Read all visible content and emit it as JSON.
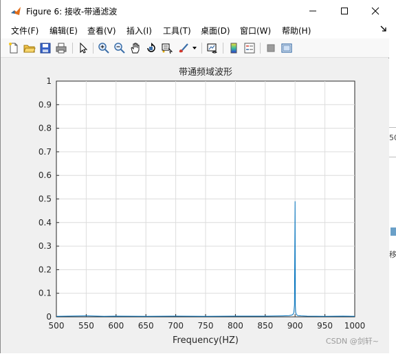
{
  "window": {
    "title": "Figure 6: 接收-带通滤波",
    "minimize_icon": "minimize-icon",
    "maximize_icon": "maximize-icon",
    "close_icon": "close-icon"
  },
  "menu": {
    "items": [
      {
        "label": "文件(F)"
      },
      {
        "label": "编辑(E)"
      },
      {
        "label": "查看(V)"
      },
      {
        "label": "插入(I)"
      },
      {
        "label": "工具(T)"
      },
      {
        "label": "桌面(D)"
      },
      {
        "label": "窗口(W)"
      },
      {
        "label": "帮助(H)"
      }
    ]
  },
  "toolbar": {
    "icons": [
      "new-figure-icon",
      "open-file-icon",
      "save-icon",
      "print-icon",
      "select-arrow-icon",
      "zoom-in-icon",
      "zoom-out-icon",
      "pan-icon",
      "rotate-3d-icon",
      "data-cursor-icon",
      "brush-icon",
      "link-plot-icon",
      "colorbar-icon",
      "legend-icon",
      "hide-plot-tools-icon",
      "show-plot-tools-icon"
    ]
  },
  "chart_data": {
    "type": "line",
    "title": "带通频域波形",
    "xlabel": "Frequency(HZ)",
    "ylabel": "",
    "xlim": [
      500,
      1000
    ],
    "ylim": [
      0,
      1
    ],
    "xticks": [
      "500",
      "550",
      "600",
      "650",
      "700",
      "750",
      "800",
      "850",
      "900",
      "950",
      "1000"
    ],
    "yticks": [
      "0",
      "0.1",
      "0.2",
      "0.3",
      "0.4",
      "0.5",
      "0.6",
      "0.7",
      "0.8",
      "0.9",
      "1"
    ],
    "grid": true,
    "line_color": "#0072BD",
    "series": [
      {
        "x": [
          500,
          520,
          550,
          580,
          600,
          650,
          700,
          750,
          800,
          850,
          880,
          890,
          895,
          897,
          898,
          899,
          900,
          900.5,
          901,
          902,
          903,
          905,
          910,
          920,
          950,
          980,
          1000
        ],
        "y": [
          0.002,
          0.003,
          0.004,
          0.002,
          0.003,
          0.002,
          0.003,
          0.002,
          0.003,
          0.003,
          0.004,
          0.005,
          0.008,
          0.012,
          0.02,
          0.05,
          0.49,
          0.05,
          0.02,
          0.012,
          0.008,
          0.005,
          0.004,
          0.003,
          0.002,
          0.003,
          0.002
        ]
      }
    ]
  },
  "right_strip": {
    "marks": [
      "50",
      "移"
    ]
  },
  "watermark": "CSDN @剑轩~"
}
